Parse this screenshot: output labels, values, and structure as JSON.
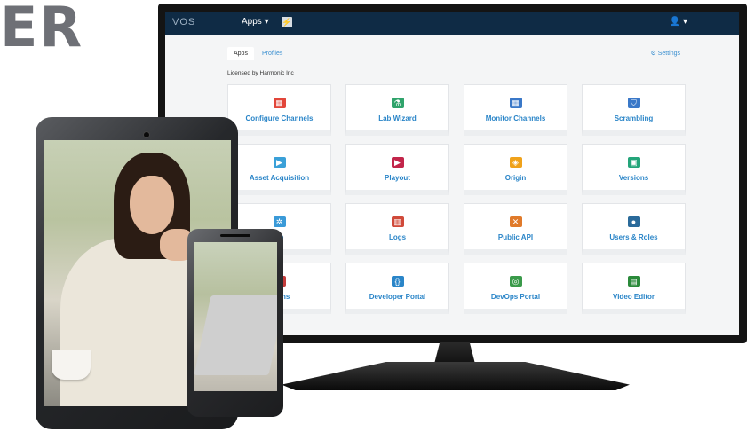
{
  "logo_text": "ER",
  "app": {
    "brand": "VOS",
    "apps_menu": "Apps ▾",
    "bolt_icon": "⚡",
    "user_menu": "👤 ▾",
    "tabs": [
      "Apps",
      "Profiles"
    ],
    "settings": "⚙ Settings",
    "license": "Licensed by Harmonic Inc"
  },
  "tiles": [
    {
      "label": "Configure Channels",
      "icon": "calendar-icon",
      "color": "#e2463a"
    },
    {
      "label": "Lab Wizard",
      "icon": "flask-icon",
      "color": "#2fa36b"
    },
    {
      "label": "Monitor Channels",
      "icon": "grid-icon",
      "color": "#3a78c8"
    },
    {
      "label": "Scrambling",
      "icon": "shield-icon",
      "color": "#3a78c8"
    },
    {
      "label": "Asset Acquisition",
      "icon": "camera-icon",
      "color": "#3aa0d8"
    },
    {
      "label": "Playout",
      "icon": "play-icon",
      "color": "#c2254a"
    },
    {
      "label": "Origin",
      "icon": "box-icon",
      "color": "#f0a21a"
    },
    {
      "label": "Versions",
      "icon": "copy-icon",
      "color": "#24a57a"
    },
    {
      "label": "ub",
      "icon": "hub-icon",
      "color": "#3a9ad8"
    },
    {
      "label": "Logs",
      "icon": "logs-icon",
      "color": "#d04a3a"
    },
    {
      "label": "Public API",
      "icon": "tools-icon",
      "color": "#e07a2a"
    },
    {
      "label": "Users & Roles",
      "icon": "user-icon",
      "color": "#2a6a9a"
    },
    {
      "label": "ations",
      "icon": "bookmark-icon",
      "color": "#c23a3a"
    },
    {
      "label": "Developer Portal",
      "icon": "braces-icon",
      "color": "#2a85c8"
    },
    {
      "label": "DevOps Portal",
      "icon": "target-icon",
      "color": "#3a9a4a"
    },
    {
      "label": "Video Editor",
      "icon": "film-icon",
      "color": "#2a8a3a"
    }
  ]
}
